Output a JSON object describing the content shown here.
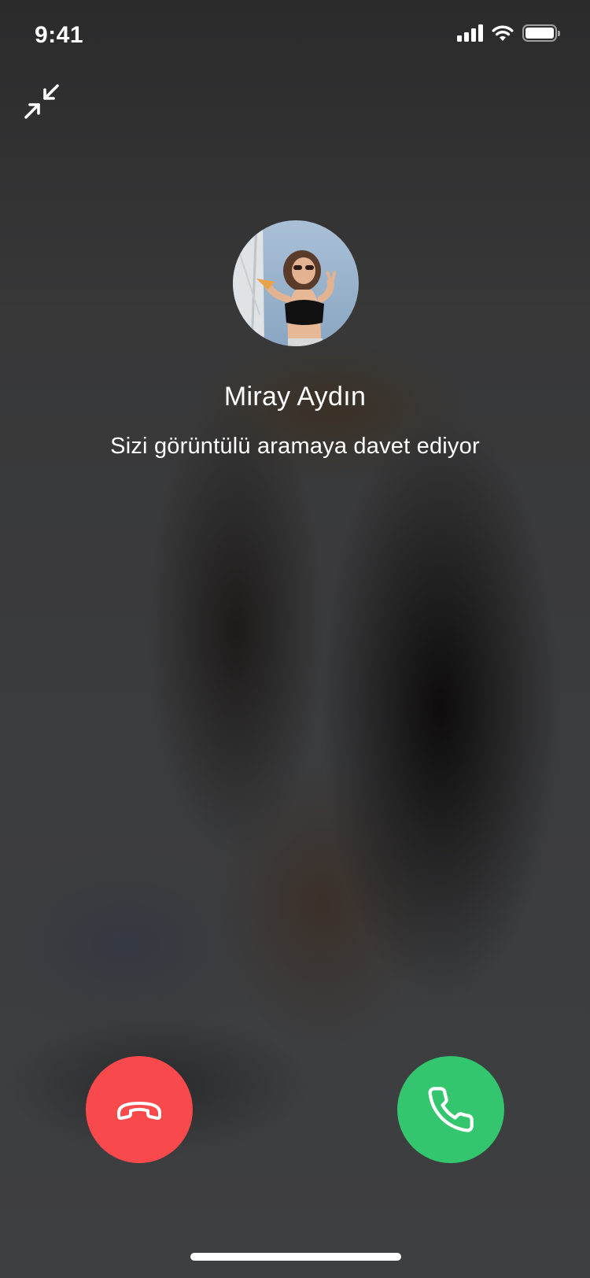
{
  "status_bar": {
    "time": "9:41",
    "signal_icon": "cellular-signal-icon",
    "wifi_icon": "wifi-icon",
    "battery_icon": "battery-icon",
    "battery_level": 1.0
  },
  "minimize": {
    "icon": "minimize-arrows-icon"
  },
  "caller": {
    "name": "Miray Aydın",
    "status": "Sizi görüntülü aramaya davet ediyor",
    "avatar_icon": "caller-avatar-photo"
  },
  "actions": {
    "decline": {
      "icon": "phone-hangup-icon",
      "color": "#F84A4C"
    },
    "accept": {
      "icon": "phone-icon",
      "color": "#33C66F"
    }
  },
  "colors": {
    "background": "#3A3B3D",
    "text": "#FFFFFF"
  }
}
